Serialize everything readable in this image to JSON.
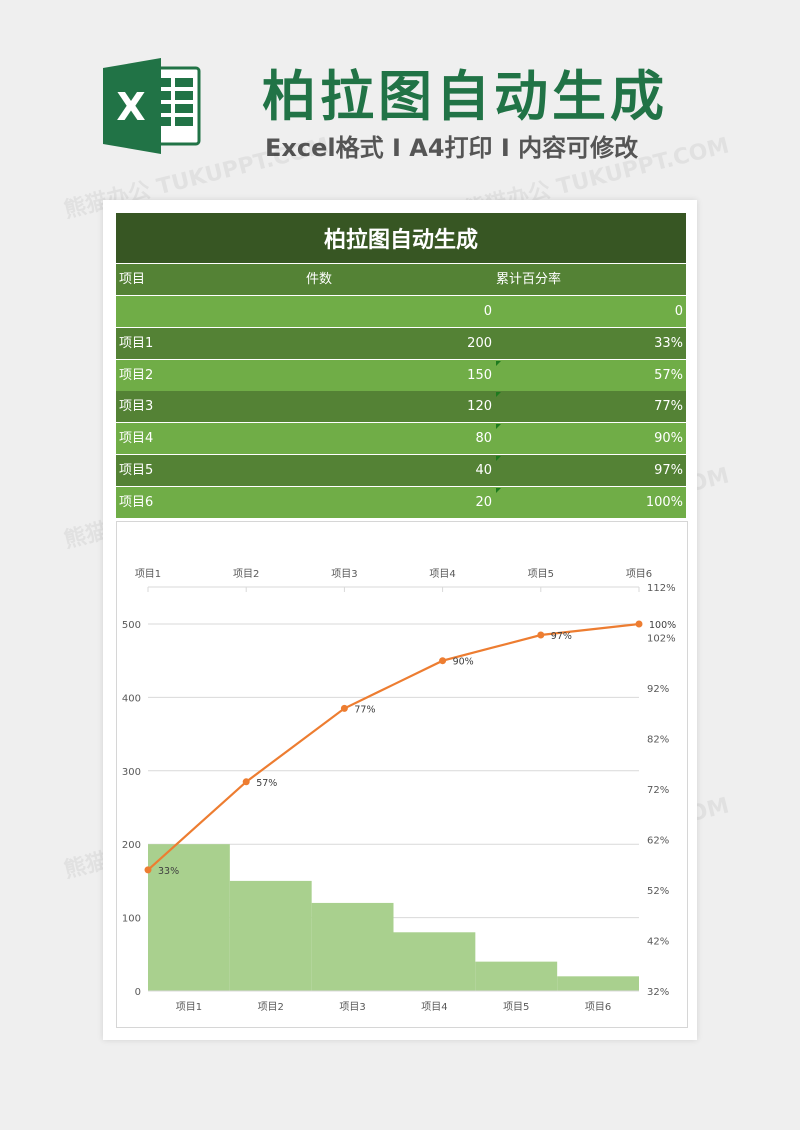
{
  "hero": {
    "title": "柏拉图自动生成",
    "subtitle": "Excel格式 Ⅰ A4打印 Ⅰ 内容可修改",
    "logo_letter": "X"
  },
  "watermark": "熊猫办公 TUKUPPT.COM",
  "table": {
    "title": "柏拉图自动生成",
    "headers": [
      "项目",
      "件数",
      "累计百分率"
    ],
    "rows": [
      {
        "name": "",
        "count": "0",
        "pct": "0"
      },
      {
        "name": "项目1",
        "count": "200",
        "pct": "33%"
      },
      {
        "name": "项目2",
        "count": "150",
        "pct": "57%"
      },
      {
        "name": "项目3",
        "count": "120",
        "pct": "77%"
      },
      {
        "name": "项目4",
        "count": "80",
        "pct": "90%"
      },
      {
        "name": "项目5",
        "count": "40",
        "pct": "97%"
      },
      {
        "name": "项目6",
        "count": "20",
        "pct": "100%"
      }
    ]
  },
  "colors": {
    "title_bg": "#375623",
    "row_dark": "#548235",
    "row_light": "#70ad47",
    "excel_green": "#217346",
    "bar_fill": "#a9d08e",
    "line": "#ed7d31"
  },
  "chart_data": {
    "type": "bar",
    "categories": [
      "项目1",
      "项目2",
      "项目3",
      "项目4",
      "项目5",
      "项目6"
    ],
    "series": [
      {
        "type": "bar",
        "axis": "left",
        "values": [
          200,
          150,
          120,
          80,
          40,
          20
        ]
      },
      {
        "type": "line",
        "axis": "right",
        "values": [
          33,
          57,
          77,
          90,
          97,
          100
        ],
        "labels": [
          "33%",
          "57%",
          "77%",
          "90%",
          "97%",
          "100%"
        ]
      }
    ],
    "y_left": {
      "min": 0,
      "max": 500,
      "ticks": [
        "0",
        "100",
        "200",
        "300",
        "400",
        "500"
      ]
    },
    "y_right": {
      "min": 32,
      "max": 112,
      "ticks": [
        "32%",
        "42%",
        "52%",
        "62%",
        "72%",
        "82%",
        "92%",
        "102%",
        "112%"
      ]
    },
    "line_y_range": [
      0,
      100
    ],
    "top_axis_labels": [
      "项目1",
      "项目2",
      "项目3",
      "项目4",
      "项目5",
      "项目6"
    ],
    "grid": true,
    "legend": "none"
  }
}
